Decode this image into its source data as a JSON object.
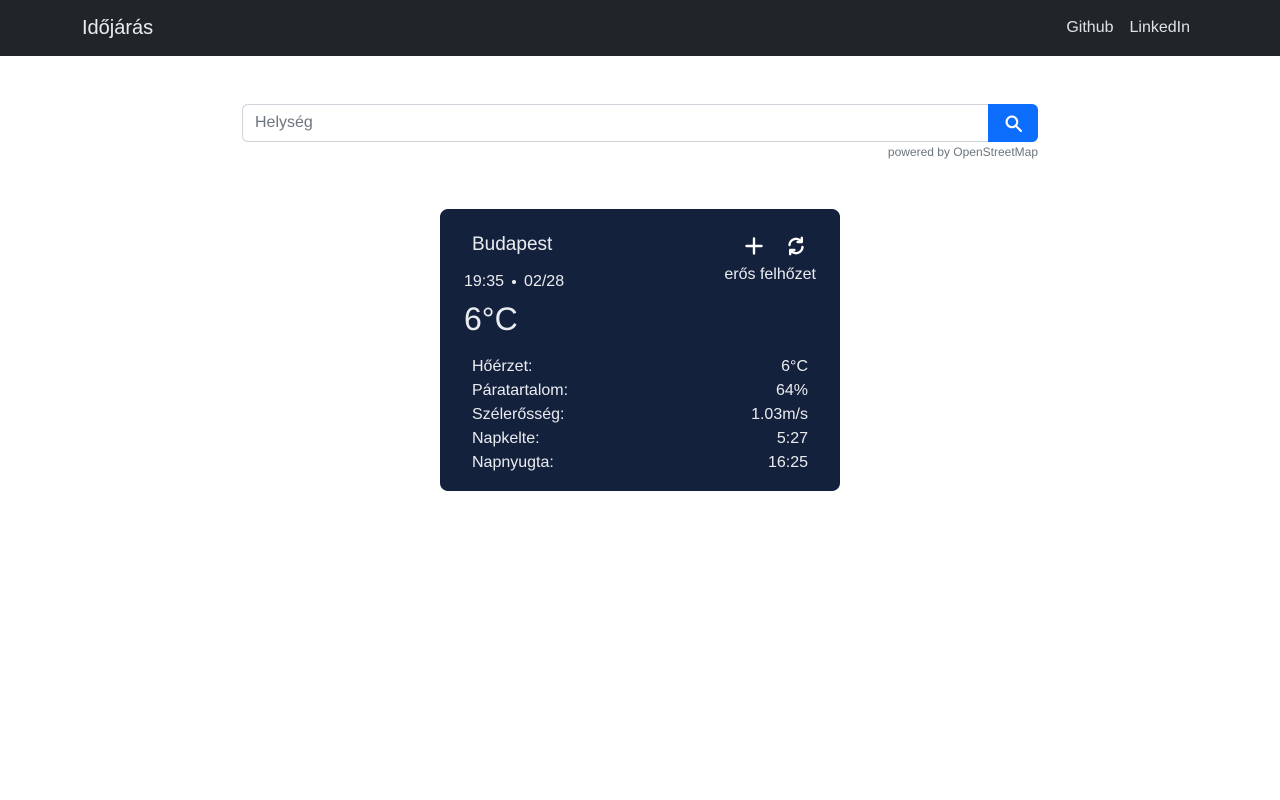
{
  "navbar": {
    "brand": "Időjárás",
    "links": [
      "Github",
      "LinkedIn"
    ]
  },
  "search": {
    "placeholder": "Helység",
    "value": "",
    "button_icon": "search-icon",
    "powered_by": "powered by OpenStreetMap"
  },
  "weather_card": {
    "city": "Budapest",
    "time": "19:35",
    "date": "02/28",
    "temperature": "6°C",
    "condition": "erős felhőzet",
    "actions": [
      "plus-icon",
      "refresh-icon"
    ],
    "details": [
      {
        "label": "Hőérzet:",
        "value": "6°C"
      },
      {
        "label": "Páratartalom:",
        "value": "64%"
      },
      {
        "label": "Szélerősség:",
        "value": "1.03m/s"
      },
      {
        "label": "Napkelte:",
        "value": "5:27"
      },
      {
        "label": "Napnyugta:",
        "value": "16:25"
      }
    ]
  },
  "colors": {
    "navbar_bg": "#212529",
    "card_bg": "#14213d",
    "accent": "#0d6efd"
  }
}
